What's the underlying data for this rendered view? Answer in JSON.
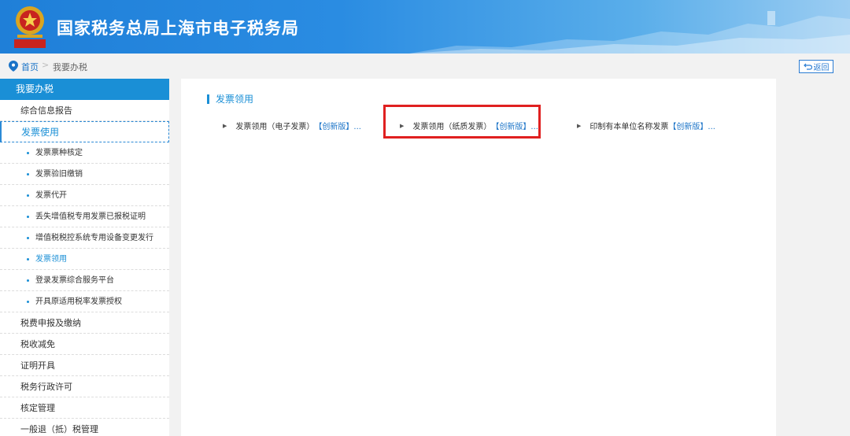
{
  "header": {
    "title": "国家税务总局上海市电子税务局",
    "emblem_text": "中国税务"
  },
  "breadcrumb": {
    "home": "首页",
    "separator": ">",
    "current": "我要办税"
  },
  "back_button": {
    "label": "返回"
  },
  "sidebar": {
    "heading": "我要办税",
    "items_top": [
      {
        "label": "综合信息报告"
      }
    ],
    "active_group": {
      "label": "发票使用"
    },
    "sub_items": [
      {
        "label": "发票票种核定"
      },
      {
        "label": "发票验旧缴销"
      },
      {
        "label": "发票代开"
      },
      {
        "label": "丢失增值税专用发票已报税证明"
      },
      {
        "label": "增值税税控系统专用设备变更发行"
      },
      {
        "label": "发票领用",
        "active": true
      },
      {
        "label": "登录发票综合服务平台"
      },
      {
        "label": "开具原适用税率发票授权"
      }
    ],
    "items_bottom": [
      {
        "label": "税费申报及缴纳"
      },
      {
        "label": "税收减免"
      },
      {
        "label": "证明开具"
      },
      {
        "label": "税务行政许可"
      },
      {
        "label": "核定管理"
      },
      {
        "label": "一般退（抵）税管理"
      }
    ]
  },
  "main": {
    "section_title": "发票领用",
    "links": [
      {
        "text": "发票领用（电子发票）",
        "tag": "【创新版】..."
      },
      {
        "text": "发票领用（纸质发票）",
        "tag": "【创新版】..."
      },
      {
        "text": "印制有本单位名称发票",
        "tag": "【创新版】..."
      }
    ]
  },
  "colors": {
    "accent": "#1a8fd6",
    "link": "#1a73c7",
    "highlight": "#e02020",
    "header_start": "#1f7fd8"
  }
}
